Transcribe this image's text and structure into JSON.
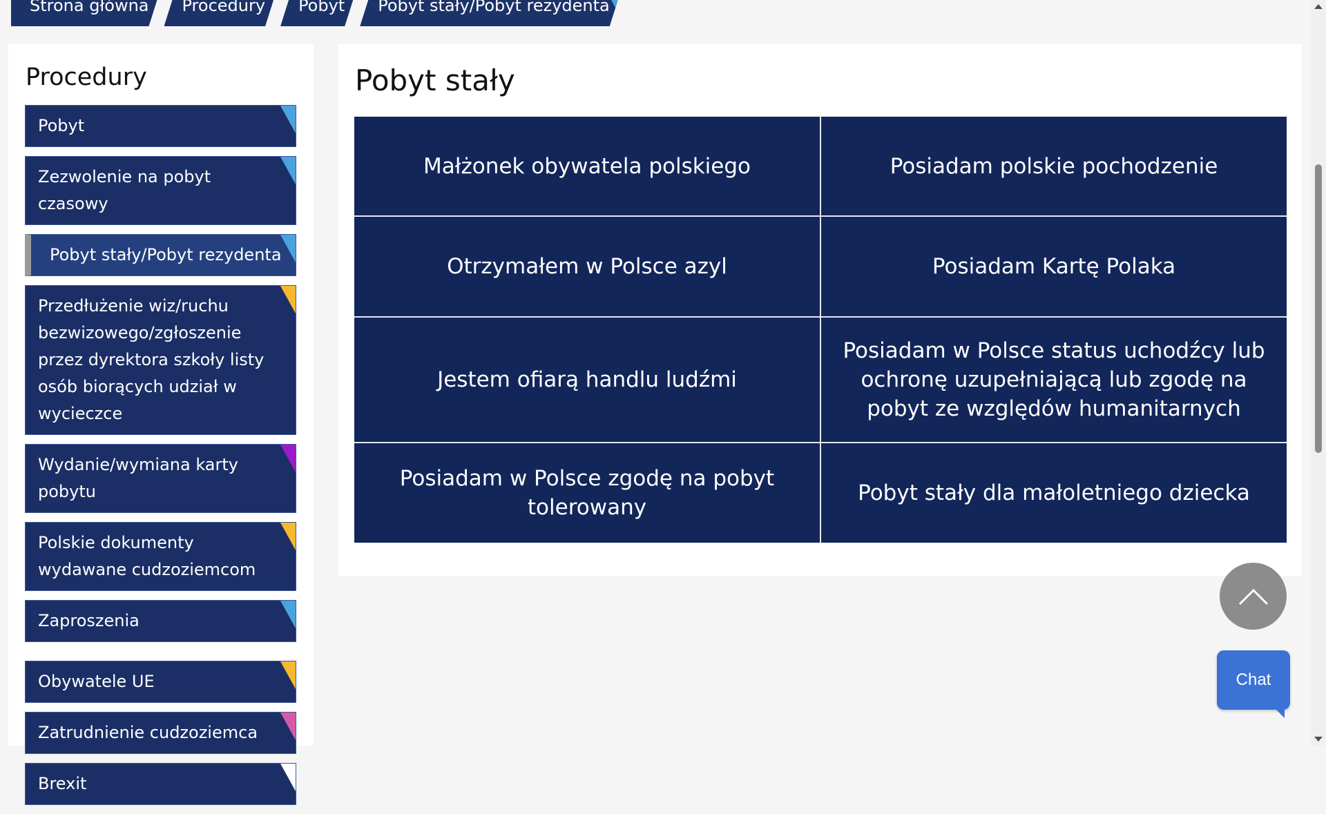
{
  "breadcrumb": [
    {
      "label": "Strona główna"
    },
    {
      "label": "Procedury"
    },
    {
      "label": "Pobyt"
    },
    {
      "label": "Pobyt stały/Pobyt rezydenta"
    }
  ],
  "sidebar": {
    "title": "Procedury",
    "items": [
      {
        "label": "Pobyt",
        "corner_color": "#4aa3df"
      },
      {
        "label": "Zezwolenie na pobyt czasowy",
        "corner_color": "#4aa3df"
      },
      {
        "label": "Pobyt stały/Pobyt rezydenta",
        "corner_color": "#4aa3df",
        "active": true
      },
      {
        "label": "Przedłużenie wiz/ruchu bezwizowego/zgłoszenie przez dyrektora szkoły listy osób biorących udział w wycieczce",
        "corner_color": "#f5b82e"
      },
      {
        "label": "Wydanie/wymiana karty pobytu",
        "corner_color": "#9b1ac9"
      },
      {
        "label": "Polskie dokumenty wydawane cudzoziemcom",
        "corner_color": "#f5b82e"
      },
      {
        "label": "Zaproszenia",
        "corner_color": "#4aa3df"
      },
      {
        "label": "Obywatele UE",
        "corner_color": "#f5b82e"
      },
      {
        "label": "Zatrudnienie cudzoziemca",
        "corner_color": "#d45aa8"
      },
      {
        "label": "Brexit",
        "corner_color": "#ffffff"
      }
    ]
  },
  "main": {
    "title": "Pobyt stały",
    "tiles": [
      "Małżonek obywatela polskiego",
      "Posiadam polskie pochodzenie",
      "Otrzymałem w Polsce azyl",
      "Posiadam Kartę Polaka",
      "Jestem ofiarą handlu ludźmi",
      "Posiadam w Polsce status uchodźcy lub ochronę uzupełniającą lub zgodę na pobyt ze względów humanitarnych",
      "Posiadam w Polsce zgodę na pobyt tolerowany",
      "Pobyt stały dla małoletniego dziecka"
    ]
  },
  "chat": {
    "label": "Chat"
  },
  "colors": {
    "navy": "#1b2f66",
    "tile_navy": "#13265a",
    "chat_blue": "#3a72d6",
    "scroll_top_gray": "#8c8c8c"
  },
  "icons": {
    "scroll_top": "chevron-up-icon"
  }
}
